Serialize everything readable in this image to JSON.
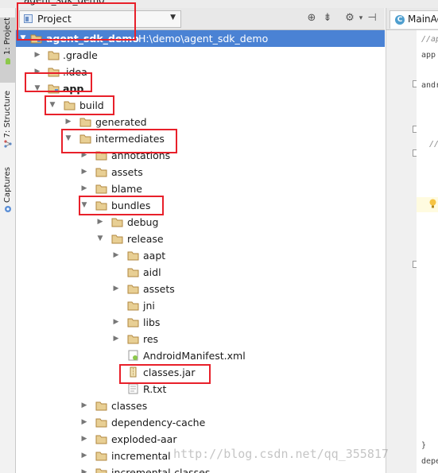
{
  "window": {
    "title": "agent_sdk_demo"
  },
  "left_tool_window_bar": {
    "tabs": [
      {
        "label": "1: Project",
        "icon": "project-tab-icon"
      },
      {
        "label": "7: Structure",
        "icon": "structure-tab-icon"
      },
      {
        "label": "Captures",
        "icon": "captures-tab-icon"
      }
    ]
  },
  "project_panel": {
    "view_selector": {
      "label": "Project",
      "icon": "project-view-icon",
      "arrow_icon": "dropdown-arrow-icon"
    },
    "header_icons": [
      "sync-icon",
      "collapse-all-icon",
      "settings-gear-icon",
      "hide-panel-icon"
    ]
  },
  "tree": {
    "root": {
      "label": "agent_sdk_demo",
      "path": "H:\\demo\\agent_sdk_demo"
    },
    "items": [
      {
        "label": ".gradle",
        "type": "folder"
      },
      {
        "label": ".idea",
        "type": "folder"
      },
      {
        "label": "app",
        "type": "module"
      },
      {
        "label": "build",
        "type": "folder"
      },
      {
        "label": "generated",
        "type": "folder"
      },
      {
        "label": "intermediates",
        "type": "folder"
      },
      {
        "label": "annotations",
        "type": "folder"
      },
      {
        "label": "assets",
        "type": "folder"
      },
      {
        "label": "blame",
        "type": "folder"
      },
      {
        "label": "bundles",
        "type": "folder"
      },
      {
        "label": "debug",
        "type": "folder"
      },
      {
        "label": "release",
        "type": "folder"
      },
      {
        "label": "aapt",
        "type": "folder"
      },
      {
        "label": "aidl",
        "type": "folder"
      },
      {
        "label": "assets",
        "type": "folder"
      },
      {
        "label": "jni",
        "type": "folder"
      },
      {
        "label": "libs",
        "type": "folder"
      },
      {
        "label": "res",
        "type": "folder"
      },
      {
        "label": "AndroidManifest.xml",
        "type": "xml-file"
      },
      {
        "label": "classes.jar",
        "type": "jar-file"
      },
      {
        "label": "R.txt",
        "type": "text-file"
      },
      {
        "label": "classes",
        "type": "folder"
      },
      {
        "label": "dependency-cache",
        "type": "folder"
      },
      {
        "label": "exploded-aar",
        "type": "folder"
      },
      {
        "label": "incremental",
        "type": "folder"
      },
      {
        "label": "incremental-classes",
        "type": "folder"
      }
    ]
  },
  "editor": {
    "tab_label": "MainAc",
    "tab_icon": "class-c-icon",
    "code_lines": [
      "//ap",
      "app",
      "andr",
      "//",
      "}",
      "depe"
    ]
  },
  "watermark": "http://blog.csdn.net/qq_355817",
  "colors": {
    "selection": "#4a82d4",
    "folder": "#c9a257",
    "highlight_box": "#e8202a"
  }
}
